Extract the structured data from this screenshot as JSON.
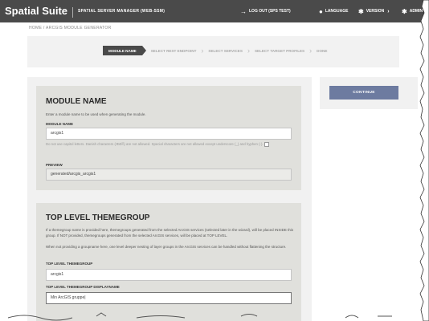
{
  "header": {
    "brand": "Spatial Suite",
    "app_name": "SPATIAL SERVER MANAGER (WEB-SSM)",
    "logout_label": "LOG OUT (SPS TEST)",
    "language_label": "LANGUAGE",
    "version_label": "VERSION",
    "admin_label": "ADMIN",
    "icons": {
      "logout": "logout-icon",
      "language": "globe-icon",
      "version": "gear-icon",
      "admin": "gear-icon"
    }
  },
  "breadcrumb": {
    "home": "HOME",
    "separator": "/",
    "current": "ARCGIS MODULE GENERATOR"
  },
  "stepper": {
    "steps": [
      {
        "label": "MODULE NAME"
      },
      {
        "label": "SELECT REST ENDPOINT"
      },
      {
        "label": "SELECT SERVICES"
      },
      {
        "label": "SELECT TARGET PROFILES"
      },
      {
        "label": "DONE"
      }
    ]
  },
  "module_name_panel": {
    "title": "MODULE NAME",
    "description": "Enter a module name to be used when generating the module.",
    "field_label": "MODULE NAME",
    "field_value": "arcgis1",
    "hint": "Do not use capitol letters. Danish characters (ÆØÅ) are not allowed. Special characters are not allowed except underscore (_) and hyphen (-).",
    "preview_label": "PREVIEW",
    "preview_value": "generated/arcgis_arcgis1"
  },
  "themegroup_panel": {
    "title": "TOP LEVEL THEMEGROUP",
    "description_1": "If a themegroup name is provided here, themegroups generated from the selected ArcGIS services (selected later in the wizard), will be placed INSIDE this group. If NOT provided, themegroups generated from the selected ArcGIS services, will be placed at TOP LEVEL.",
    "description_2": "When not providing a groupname here, one level deeper nesting of layer groups in the ArcGIS services can be handled without flattening the structure.",
    "themegroup_label": "TOP LEVEL THEMEGROUP",
    "themegroup_value": "arcgis1",
    "displayname_label": "TOP LEVEL THEMEGROUP DISPLAYNAME",
    "displayname_value": "Min ArcGIS gruppe|"
  },
  "actions": {
    "continue_label": "CONTINUE"
  },
  "colors": {
    "header_bg": "#4a4a4a",
    "continue_bg": "#6d7ba0",
    "panel_bg": "#e0e0dc"
  }
}
